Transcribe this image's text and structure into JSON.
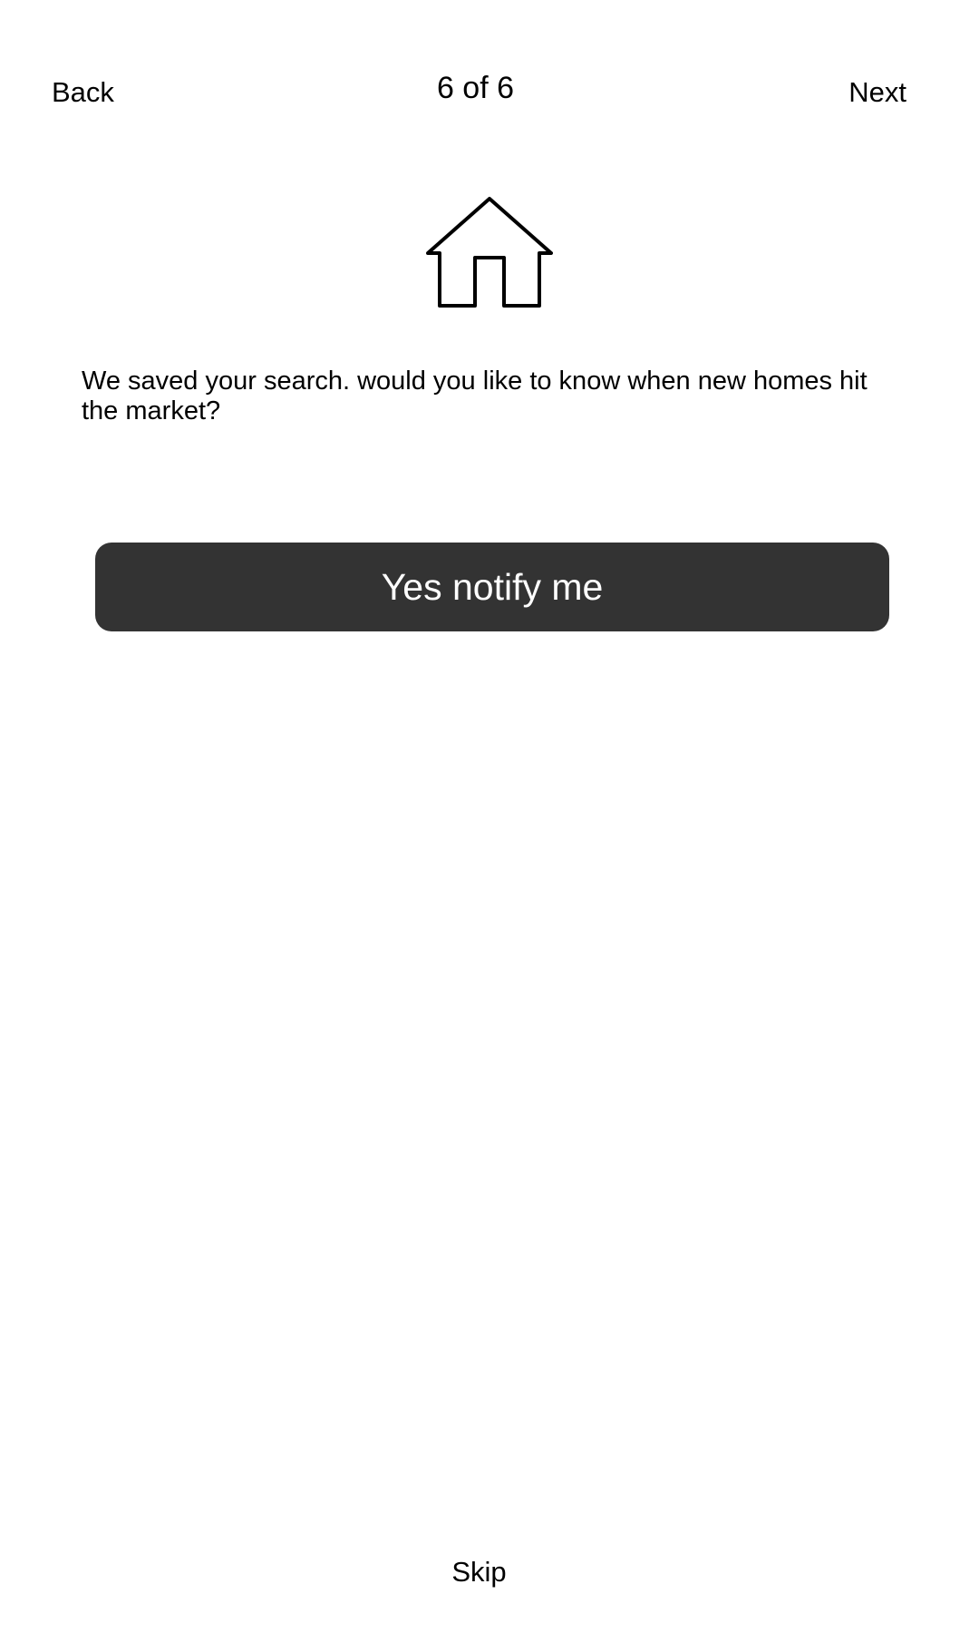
{
  "header": {
    "back_label": "Back",
    "step_indicator": "6 of 6",
    "next_label": "Next"
  },
  "main": {
    "icon": "house-icon",
    "message": "We saved your search. would you like to know when new homes hit the market?",
    "cta_label": "Yes notify me"
  },
  "footer": {
    "skip_label": "Skip"
  },
  "colors": {
    "background": "#ffffff",
    "button_background": "#333333",
    "button_text": "#ffffff",
    "text": "#000000"
  }
}
